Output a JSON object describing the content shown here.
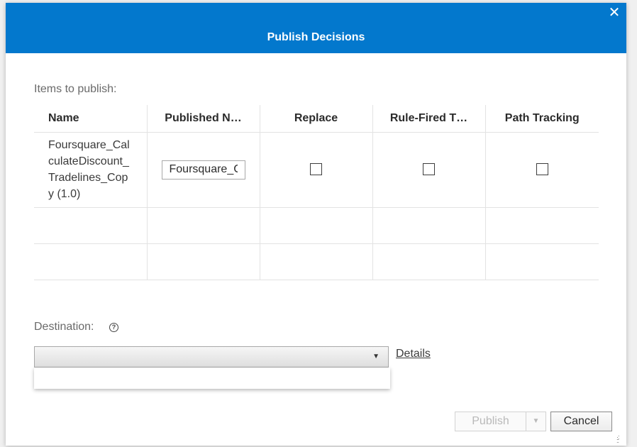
{
  "dialog": {
    "title": "Publish Decisions",
    "close_glyph": "✕"
  },
  "items_label": "Items to publish:",
  "table": {
    "columns": [
      "Name",
      "Published N…",
      "Replace",
      "Rule-Fired T…",
      "Path Tracking"
    ],
    "rows": [
      {
        "name": "Foursquare_CalculateDiscount_Tradelines_Copy (1.0)",
        "published_name": "Foursquare_CalculateDiscount_Tradelines_Copy",
        "replace": false,
        "rule_fired_tracking": false,
        "path_tracking": false
      }
    ]
  },
  "destination": {
    "label": "Destination:",
    "value": "",
    "help_icon": "question-circle-icon"
  },
  "details_link": "Details",
  "buttons": {
    "publish": "Publish",
    "cancel": "Cancel"
  },
  "colors": {
    "header": "#0378cd",
    "header_text": "#ffffff"
  }
}
